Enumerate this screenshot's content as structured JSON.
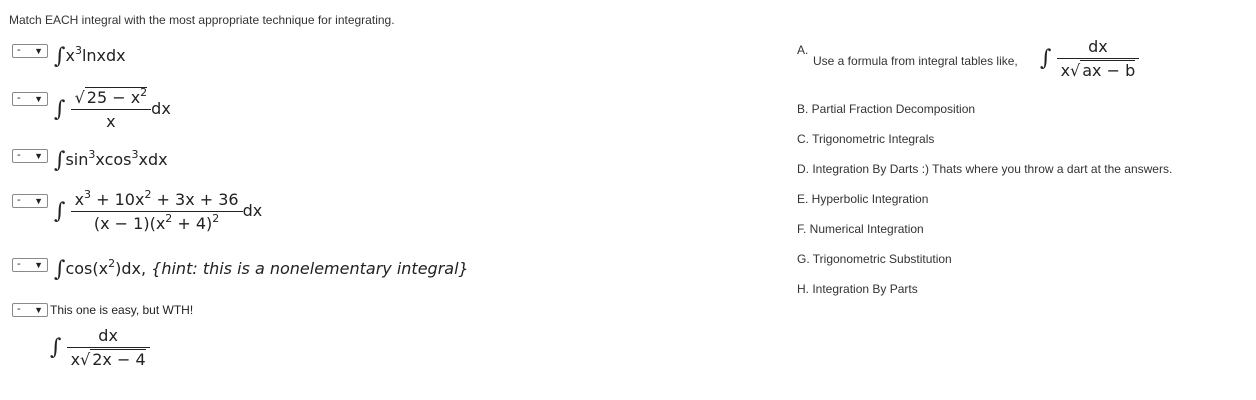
{
  "instruction": "Match EACH integral with the most appropriate technique for integrating.",
  "dropdown_value": "-",
  "questions": [
    {
      "integral_sign": "∫",
      "expr_prefix": "x",
      "expr_sup": "3",
      "expr_suffix": "lnxdx"
    },
    {
      "integral_sign": "∫",
      "num_sqrt_body": "25 − x",
      "num_sup": "2",
      "den": "x",
      "dx": "dx"
    },
    {
      "integral_sign": "∫",
      "p1": "sin",
      "s1": "3",
      "p2": "xcos",
      "s2": "3",
      "p3": "xdx"
    },
    {
      "integral_sign": "∫",
      "n1": "x",
      "ns1": "3",
      "n2": " + 10x",
      "ns2": "2",
      "n3": " + 3x + 36",
      "d1": "(x − 1)(x",
      "ds1": "2",
      "d2": " + 4)",
      "ds2": "2",
      "dx": "dx"
    },
    {
      "integral_sign": "∫",
      "p1": "cos(x",
      "s1": "2",
      "p2": ")dx,",
      "hint": "{hint: this is a nonelementary integral}"
    },
    {
      "label": "This one is easy, but WTH!",
      "integral_sign": "∫",
      "num": "dx",
      "den_prefix": "x",
      "den_sqrt": "2x − 4"
    }
  ],
  "answers": {
    "a_letter": "A.",
    "a_text": "Use a formula from integral tables like,",
    "a_formula": {
      "integral_sign": "∫",
      "num": "dx",
      "den_prefix": "x",
      "den_sqrt": "ax − b"
    },
    "b": "B. Partial Fraction Decomposition",
    "c": "C. Trigonometric Integrals",
    "d": "D. Integration By Darts :) Thats where you throw a dart at the answers.",
    "e": "E. Hyperbolic Integration",
    "f": "F. Numerical Integration",
    "g": "G. Trigonometric Substitution",
    "h": "H. Integration By Parts"
  }
}
